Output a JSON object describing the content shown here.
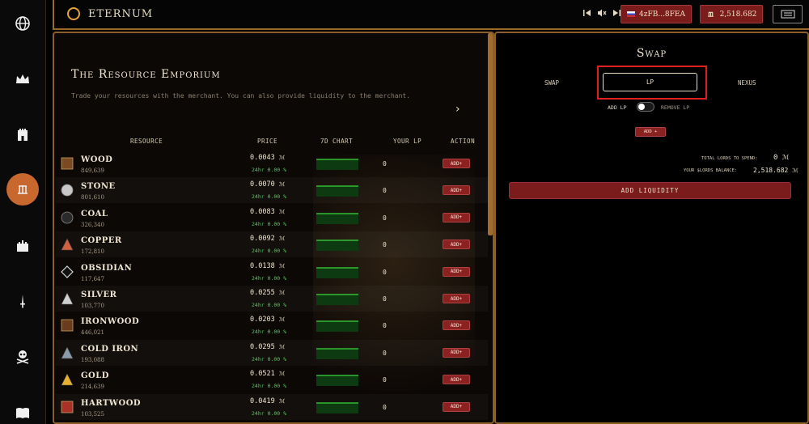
{
  "app": {
    "title": "ETERNUM"
  },
  "nav": [
    "globe-icon",
    "crown-icon",
    "tower-icon",
    "lords-icon",
    "castle-icon",
    "sword-icon",
    "skull-icon",
    "book-icon"
  ],
  "topbar": {
    "account": "4zFB...8FEA",
    "lords_balance": "2,518.682"
  },
  "emporium": {
    "title": "The Resource Emporium",
    "description": "Trade your resources with the merchant. You can also provide liquidity to the merchant.",
    "columns": {
      "resource": "RESOURCE",
      "price": "PRICE",
      "chart": "7D CHART",
      "lp": "YOUR LP",
      "action": "ACTION"
    },
    "rows": [
      {
        "name": "WOOD",
        "qty": "849,639",
        "price": "0.0043",
        "change": "24hr 0.00 %",
        "lp": "0",
        "action": "ADD+",
        "color": "#7a4a22"
      },
      {
        "name": "STONE",
        "qty": "801,610",
        "price": "0.0070",
        "change": "24hr 0.00 %",
        "lp": "0",
        "action": "ADD+",
        "color": "#c8c8c8"
      },
      {
        "name": "COAL",
        "qty": "326,340",
        "price": "0.0083",
        "change": "24hr 0.00 %",
        "lp": "0",
        "action": "ADD+",
        "color": "#2a2a2a"
      },
      {
        "name": "COPPER",
        "qty": "172,810",
        "price": "0.0092",
        "change": "24hr 0.00 %",
        "lp": "0",
        "action": "ADD+",
        "color": "#d06040"
      },
      {
        "name": "OBSIDIAN",
        "qty": "117,647",
        "price": "0.0138",
        "change": "24hr 0.00 %",
        "lp": "0",
        "action": "ADD+",
        "color": "#d8d8d8"
      },
      {
        "name": "SILVER",
        "qty": "103,770",
        "price": "0.0255",
        "change": "24hr 0.00 %",
        "lp": "0",
        "action": "ADD+",
        "color": "#d0d0d0"
      },
      {
        "name": "IRONWOOD",
        "qty": "446,021",
        "price": "0.0203",
        "change": "24hr 0.00 %",
        "lp": "0",
        "action": "ADD+",
        "color": "#6a3c1e"
      },
      {
        "name": "COLD IRON",
        "qty": "193,088",
        "price": "0.0295",
        "change": "24hr 0.00 %",
        "lp": "0",
        "action": "ADD+",
        "color": "#8a9aa8"
      },
      {
        "name": "GOLD",
        "qty": "214,639",
        "price": "0.0521",
        "change": "24hr 0.00 %",
        "lp": "0",
        "action": "ADD+",
        "color": "#e8b030"
      },
      {
        "name": "HARTWOOD",
        "qty": "103,525",
        "price": "0.0419",
        "change": "24hr 0.00 %",
        "lp": "0",
        "action": "ADD+",
        "color": "#a83228"
      }
    ]
  },
  "swap": {
    "title": "Swap",
    "tabs": {
      "swap": "SWAP",
      "lp": "LP",
      "nexus": "NEXUS"
    },
    "add_lp": "ADD LP",
    "remove_lp": "REMOVE LP",
    "add_button": "ADD +",
    "total_label": "TOTAL LORDS TO SPEND:",
    "total_value": "0",
    "balance_label": "YOUR $LORDS BALANCE:",
    "balance_value": "2,518.682",
    "add_liquidity": "ADD LIQUIDITY"
  }
}
